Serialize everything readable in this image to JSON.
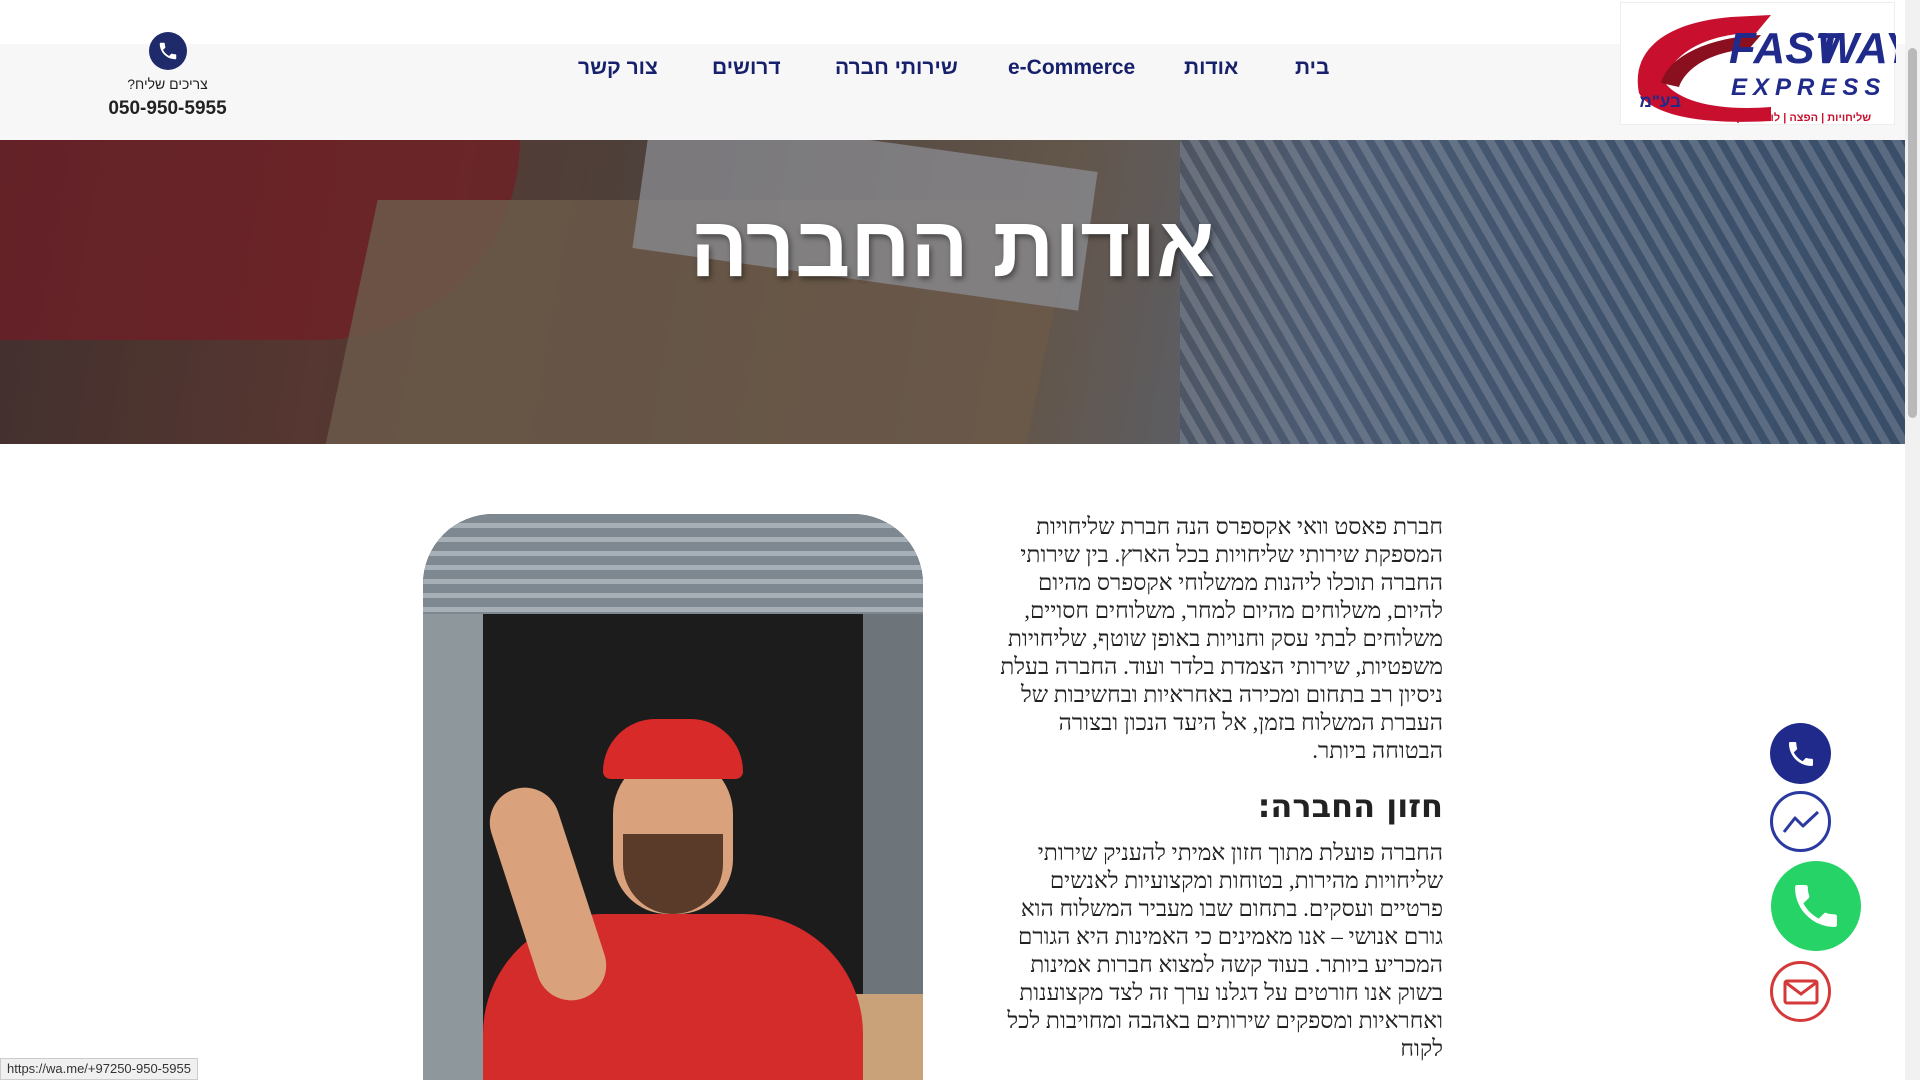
{
  "header": {
    "logo_alt": "FASTWAY EXPRESS",
    "logo_word1": "FAST",
    "logo_word2": "WAY",
    "logo_word3": "EXPRESS",
    "logo_suffix": "בע\"מ",
    "logo_tagline": "שליחויות | הפצה | לוגיסטיקה",
    "nav": [
      {
        "label": "בית"
      },
      {
        "label": "אודות"
      },
      {
        "label": "e-Commerce"
      },
      {
        "label": "שירותי חברה"
      },
      {
        "label": "דרושים"
      },
      {
        "label": "צור קשר"
      }
    ],
    "contact_question": "צריכים שליח?",
    "contact_phone": "050-950-5955"
  },
  "hero": {
    "title": "אודות החברה"
  },
  "content": {
    "intro": "חברת פאסט וואי אקספרס הנה חברת שליחויות המספקת שירותי שליחויות בכל הארץ. בין שירותי החברה תוכלו ליהנות ממשלוחי אקספרס מהיום להיום, משלוחים מהיום למחר, משלוחים חסויים, משלוחים לבתי עסק וחנויות באופן שוטף, שליחויות משפטיות, שירותי הצמדת בלדר ועוד. החברה בעלת ניסיון רב בתחום ומכירה באחראיות ובחשיבות של העברת המשלוח בזמן, אל היעד הנכון ובצורה הבטוחה ביותר.",
    "vision_heading": "חזון החברה:",
    "vision_text": "החברה פועלת מתוך חזון אמיתי להעניק שירותי שליחויות מהירות, בטוחות ומקצועיות לאנשים פרטיים ועסקים. בתחום שבו מעביר המשלוח הוא גורם אנושי – אנו מאמינים כי האמינות היא הגורם המכריע ביותר. בעוד קשה למצוא חברות אמינות בשוק אנו חורטים על דגלנו ערך זה לצד מקצוענות ואחראיות ומספקים שירותים באהבה ומחויבות לכל לקוח"
  },
  "floating": {
    "phone": "phone-icon",
    "messenger": "messenger-icon",
    "whatsapp": "whatsapp-icon",
    "email": "email-icon"
  },
  "status_bar": {
    "url": "https://wa.me/+97250-950-5955"
  },
  "colors": {
    "nav_text": "#17206b",
    "brand_red": "#d42b2b",
    "brand_navy": "#1f2a6b",
    "whatsapp": "#25d366",
    "email": "#d43a3a"
  }
}
